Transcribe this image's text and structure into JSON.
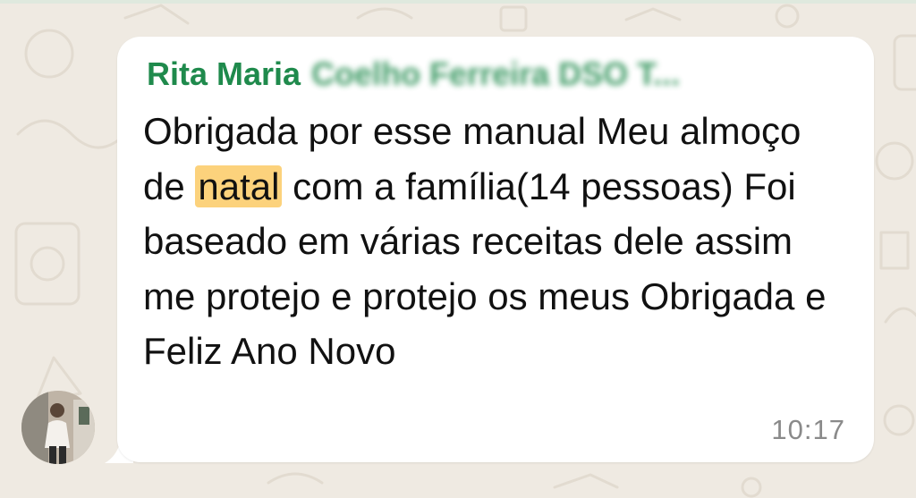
{
  "chat": {
    "background_color": "#efeae2",
    "bubble_color": "#ffffff",
    "accent_color": "#1f8a4c",
    "highlight_color": "#fcd27c"
  },
  "message": {
    "sender_name": "Rita Maria",
    "sender_obscured": "Coelho Ferreira DSO T...",
    "text_before_highlight": "Obrigada por esse manual Meu almoço de ",
    "highlight_word": "natal",
    "text_after_highlight": " com a família(14 pessoas) Foi baseado em várias receitas dele assim me protejo e protejo os meus Obrigada e Feliz Ano Novo",
    "time": "10:17"
  },
  "avatar": {
    "icon": "profile-photo"
  }
}
